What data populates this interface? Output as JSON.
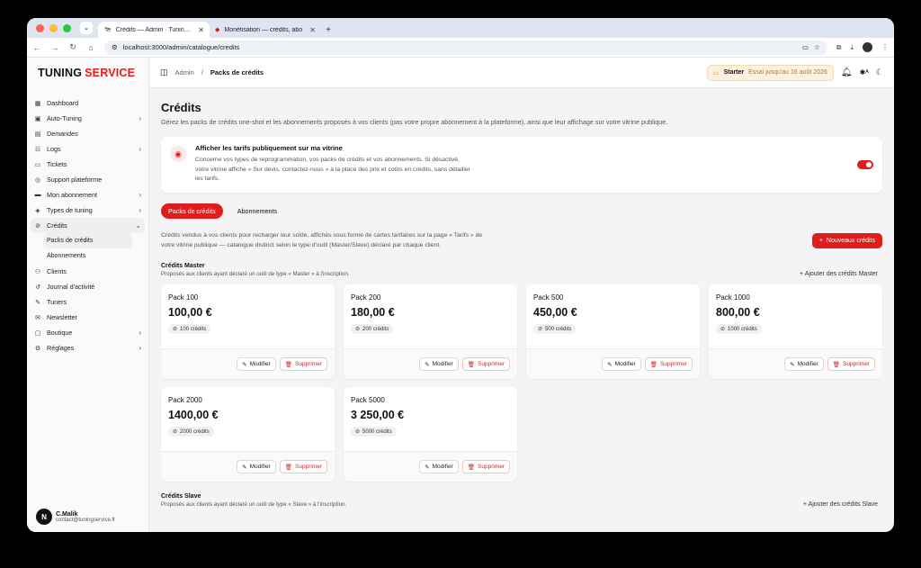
{
  "browser": {
    "tabs": [
      {
        "title": "Crédits — Admin · Tuning Ser",
        "active": true
      },
      {
        "title": "Monétisation — crédits, abo",
        "active": false
      }
    ],
    "url": "localhost:3000/admin/catalogue/credits"
  },
  "sidebar": {
    "brand_a": "TUNING",
    "brand_b": "SERVICE",
    "items": [
      {
        "label": "Dashboard",
        "icon": "dashboard-icon"
      },
      {
        "label": "Auto-Tuning",
        "icon": "auto-tuning-icon",
        "chevron": true
      },
      {
        "label": "Demandes",
        "icon": "requests-icon"
      },
      {
        "label": "Logs",
        "icon": "logs-icon",
        "chevron": true
      },
      {
        "label": "Tickets",
        "icon": "ticket-icon"
      },
      {
        "label": "Support plateforme",
        "icon": "support-icon"
      },
      {
        "label": "Mon abonnement",
        "icon": "subscription-icon",
        "chevron": true
      },
      {
        "label": "Types de tuning",
        "icon": "tuning-types-icon",
        "chevron": true
      },
      {
        "label": "Crédits",
        "icon": "credits-icon",
        "chevron": true
      },
      {
        "label": "Packs de crédits"
      },
      {
        "label": "Abonnements"
      },
      {
        "label": "Clients",
        "icon": "clients-icon"
      },
      {
        "label": "Journal d'activité",
        "icon": "activity-icon"
      },
      {
        "label": "Tuners",
        "icon": "tuners-icon"
      },
      {
        "label": "Newsletter",
        "icon": "newsletter-icon"
      },
      {
        "label": "Boutique",
        "icon": "shop-icon",
        "chevron": true
      },
      {
        "label": "Réglages",
        "icon": "settings-icon",
        "chevron": true
      }
    ],
    "user": {
      "initial": "N",
      "name": "C.Malik",
      "email": "contact@tuningservice.fr"
    }
  },
  "topbar": {
    "crumb_parent": "Admin",
    "crumb_current": "Packs de crédits",
    "plan_name": "Starter",
    "plan_note": "Essai jusqu'au 16 août 2026"
  },
  "page": {
    "title": "Crédits",
    "description": "Gérez les packs de crédits one-shot et les abonnements proposés à vos clients (pas votre propre abonnement à la plateforme), ainsi que leur affichage sur votre vitrine publique.",
    "vitrine_title": "Afficher les tarifs publiquement sur ma vitrine",
    "vitrine_desc": "Concerne vos types de reprogrammation, vos packs de crédits et vos abonnements. Si désactivé, votre vitrine affiche « Sur devis, contactez-nous » à la place des prix et coûts en crédits, sans détailler les tarifs.",
    "vitrine_enabled": true,
    "tab_packs": "Packs de crédits",
    "tab_subs": "Abonnements",
    "intro": "Crédits vendus à vos clients pour recharger leur solde, affichés sous forme de cartes tarifaires sur la page « Tarifs » de votre vitrine publique — catalogue distinct selon le type d'outil (Master/Slave) déclaré par chaque client.",
    "new_button": "Nouveaux crédits",
    "master_title": "Crédits Master",
    "master_sub": "Proposés aux clients ayant déclaré un outil de type « Master » à l'inscription.",
    "master_add": "Ajouter des crédits Master",
    "slave_title": "Crédits Slave",
    "slave_sub": "Proposés aux clients ayant déclaré un outil de type « Slave » à l'inscription.",
    "slave_add": "Ajouter des crédits Slave",
    "edit_label": "Modifier",
    "delete_label": "Supprimer"
  },
  "packs": [
    {
      "name": "Pack 100",
      "price": "100,00 €",
      "credits": "100 crédits"
    },
    {
      "name": "Pack 200",
      "price": "180,00 €",
      "credits": "200 crédits"
    },
    {
      "name": "Pack 500",
      "price": "450,00 €",
      "credits": "500 crédits"
    },
    {
      "name": "Pack 1000",
      "price": "800,00 €",
      "credits": "1000 crédits"
    },
    {
      "name": "Pack 2000",
      "price": "1400,00 €",
      "credits": "2000 crédits"
    },
    {
      "name": "Pack 5000",
      "price": "3 250,00 €",
      "credits": "5000 crédits"
    }
  ],
  "colors": {
    "accent": "#e01d1d"
  }
}
